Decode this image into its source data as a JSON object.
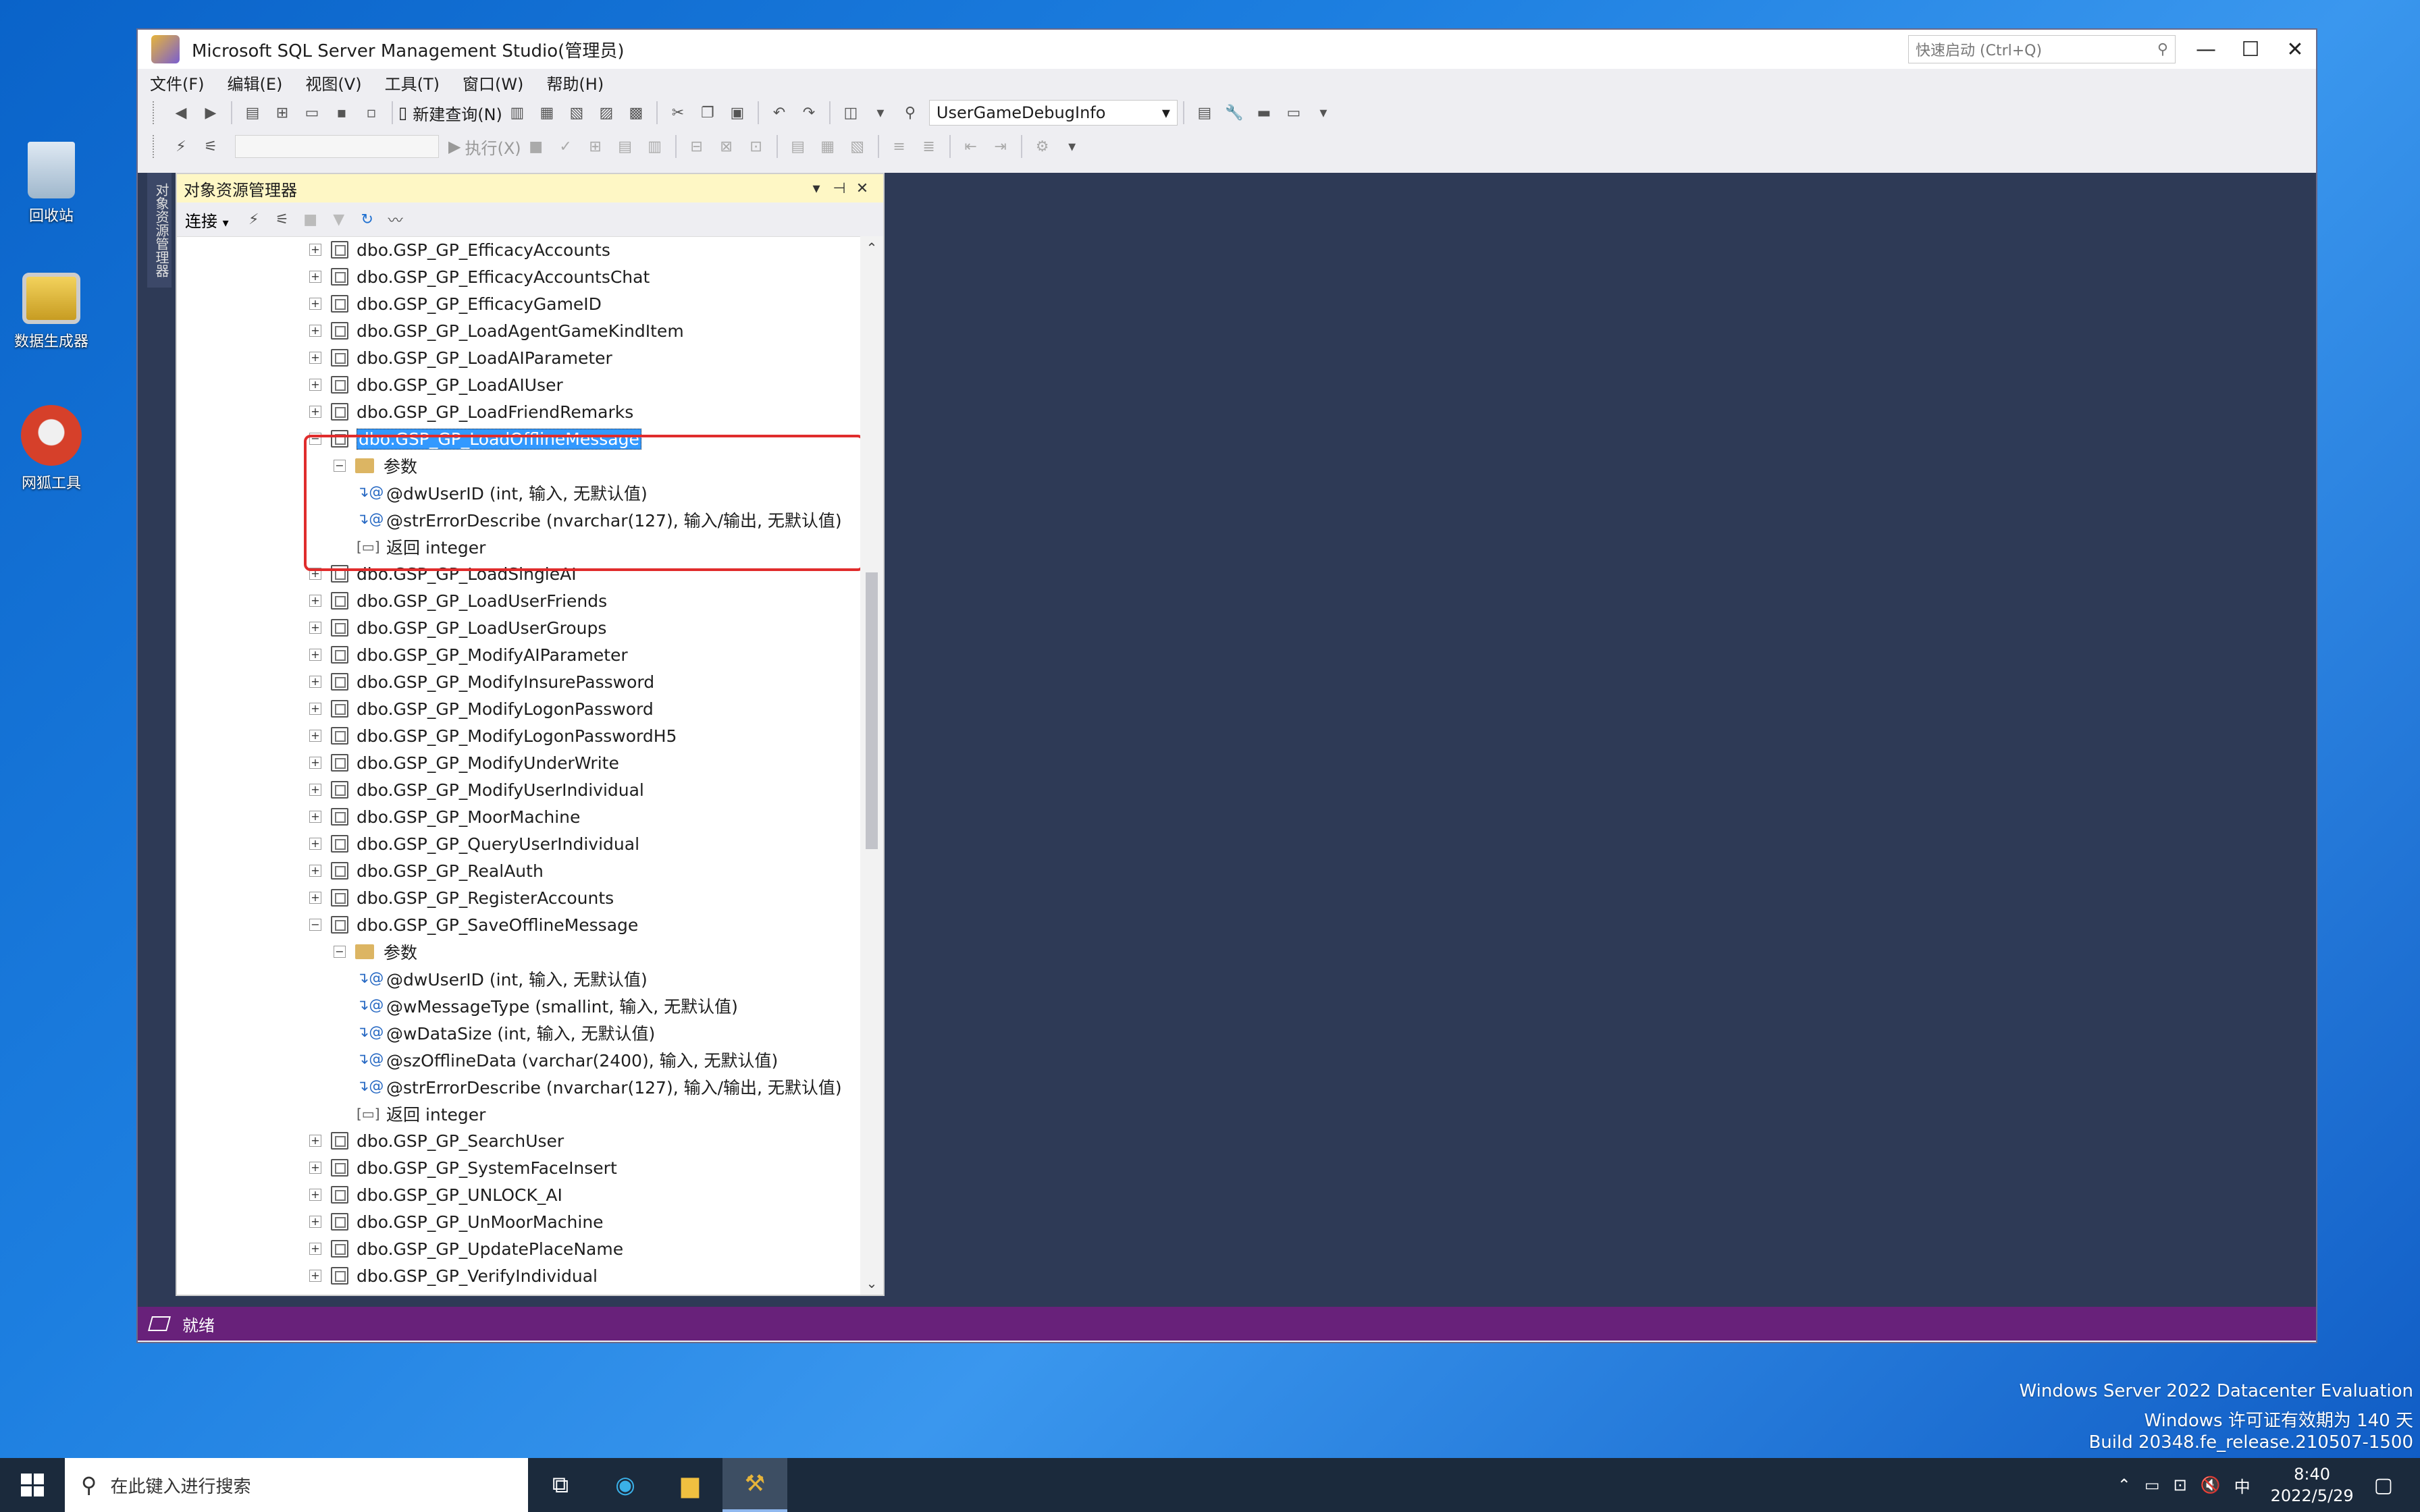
{
  "desktop": {
    "icons": [
      {
        "label": "回收站",
        "icon": "recycle-bin-icon"
      },
      {
        "label": "数据生成器",
        "icon": "computer-icon"
      },
      {
        "label": "网狐工具",
        "icon": "fox-icon"
      }
    ],
    "watermark": {
      "line1": "Windows Server 2022 Datacenter Evaluation",
      "line2": "Windows 许可证有效期为 140 天",
      "line3": "Build 20348.fe_release.210507-1500"
    }
  },
  "window": {
    "title": "Microsoft SQL Server Management Studio(管理员)",
    "quick_launch_placeholder": "快速启动 (Ctrl+Q)",
    "controls": {
      "minimize": "—",
      "maximize": "☐",
      "close": "✕"
    },
    "menu": [
      "文件(F)",
      "编辑(E)",
      "视图(V)",
      "工具(T)",
      "窗口(W)",
      "帮助(H)"
    ],
    "toolbar": {
      "new_query": "新建查询(N)",
      "database": "UserGameDebugInfo",
      "execute": "执行(X)"
    },
    "status": "就绪"
  },
  "object_explorer": {
    "title": "对象资源管理器",
    "side_tab": "对象资源管理器",
    "connect_label": "连接",
    "tree": [
      {
        "type": "proc",
        "label": "dbo.GSP_GP_EfficacyAccounts",
        "expanded": false
      },
      {
        "type": "proc",
        "label": "dbo.GSP_GP_EfficacyAccountsChat",
        "expanded": false
      },
      {
        "type": "proc",
        "label": "dbo.GSP_GP_EfficacyGameID",
        "expanded": false
      },
      {
        "type": "proc",
        "label": "dbo.GSP_GP_LoadAgentGameKindItem",
        "expanded": false
      },
      {
        "type": "proc",
        "label": "dbo.GSP_GP_LoadAIParameter",
        "expanded": false
      },
      {
        "type": "proc",
        "label": "dbo.GSP_GP_LoadAIUser",
        "expanded": false
      },
      {
        "type": "proc",
        "label": "dbo.GSP_GP_LoadFriendRemarks",
        "expanded": false
      },
      {
        "type": "proc",
        "label": "dbo.GSP_GP_LoadOfflineMessage",
        "expanded": true,
        "selected": true
      },
      {
        "type": "folder",
        "label": "参数"
      },
      {
        "type": "param",
        "label": "@dwUserID (int, 输入, 无默认值)"
      },
      {
        "type": "param",
        "label": "@strErrorDescribe (nvarchar(127), 输入/输出, 无默认值)"
      },
      {
        "type": "return",
        "label": "返回 integer"
      },
      {
        "type": "proc",
        "label": "dbo.GSP_GP_LoadSingleAI",
        "expanded": false
      },
      {
        "type": "proc",
        "label": "dbo.GSP_GP_LoadUserFriends",
        "expanded": false
      },
      {
        "type": "proc",
        "label": "dbo.GSP_GP_LoadUserGroups",
        "expanded": false
      },
      {
        "type": "proc",
        "label": "dbo.GSP_GP_ModifyAIParameter",
        "expanded": false
      },
      {
        "type": "proc",
        "label": "dbo.GSP_GP_ModifyInsurePassword",
        "expanded": false
      },
      {
        "type": "proc",
        "label": "dbo.GSP_GP_ModifyLogonPassword",
        "expanded": false
      },
      {
        "type": "proc",
        "label": "dbo.GSP_GP_ModifyLogonPasswordH5",
        "expanded": false
      },
      {
        "type": "proc",
        "label": "dbo.GSP_GP_ModifyUnderWrite",
        "expanded": false
      },
      {
        "type": "proc",
        "label": "dbo.GSP_GP_ModifyUserIndividual",
        "expanded": false
      },
      {
        "type": "proc",
        "label": "dbo.GSP_GP_MoorMachine",
        "expanded": false
      },
      {
        "type": "proc",
        "label": "dbo.GSP_GP_QueryUserIndividual",
        "expanded": false
      },
      {
        "type": "proc",
        "label": "dbo.GSP_GP_RealAuth",
        "expanded": false
      },
      {
        "type": "proc",
        "label": "dbo.GSP_GP_RegisterAccounts",
        "expanded": false
      },
      {
        "type": "proc",
        "label": "dbo.GSP_GP_SaveOfflineMessage",
        "expanded": true
      },
      {
        "type": "folder",
        "label": "参数"
      },
      {
        "type": "param",
        "label": "@dwUserID (int, 输入, 无默认值)"
      },
      {
        "type": "param",
        "label": "@wMessageType (smallint, 输入, 无默认值)"
      },
      {
        "type": "param",
        "label": "@wDataSize (int, 输入, 无默认值)"
      },
      {
        "type": "param",
        "label": "@szOfflineData (varchar(2400), 输入, 无默认值)"
      },
      {
        "type": "param",
        "label": "@strErrorDescribe (nvarchar(127), 输入/输出, 无默认值)"
      },
      {
        "type": "return",
        "label": "返回 integer"
      },
      {
        "type": "proc",
        "label": "dbo.GSP_GP_SearchUser",
        "expanded": false
      },
      {
        "type": "proc",
        "label": "dbo.GSP_GP_SystemFaceInsert",
        "expanded": false
      },
      {
        "type": "proc",
        "label": "dbo.GSP_GP_UNLOCK_AI",
        "expanded": false
      },
      {
        "type": "proc",
        "label": "dbo.GSP_GP_UnMoorMachine",
        "expanded": false
      },
      {
        "type": "proc",
        "label": "dbo.GSP_GP_UpdatePlaceName",
        "expanded": false
      },
      {
        "type": "proc",
        "label": "dbo.GSP_GP_VerifyIndividual",
        "expanded": false
      }
    ]
  },
  "taskbar": {
    "search_placeholder": "在此键入进行搜索",
    "ime": "中",
    "time": "8:40",
    "date": "2022/5/29"
  }
}
